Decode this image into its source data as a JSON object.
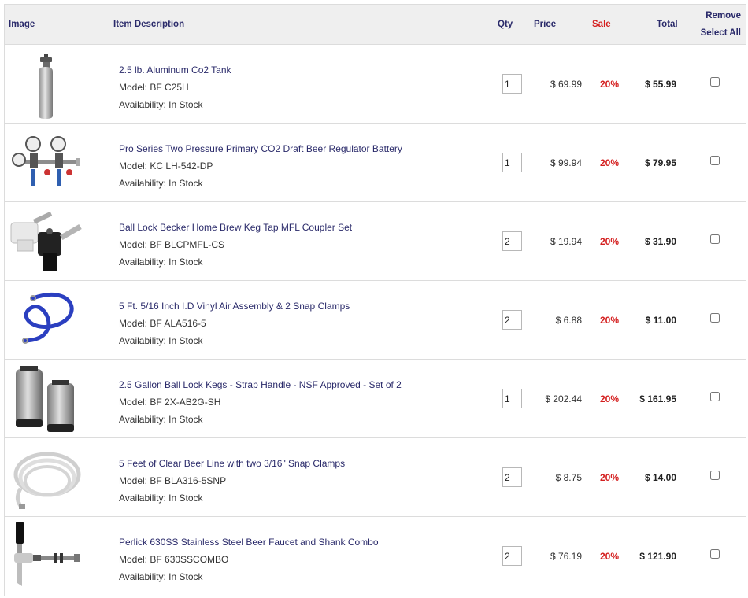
{
  "header": {
    "image": "Image",
    "description": "Item Description",
    "qty": "Qty",
    "price": "Price",
    "sale": "Sale",
    "total": "Total",
    "remove": "Remove",
    "select_all": "Select All"
  },
  "items": [
    {
      "title": "2.5 lb. Aluminum Co2 Tank",
      "model": "Model: BF C25H",
      "availability": "Availability: In Stock",
      "qty": "1",
      "price": "$ 69.99",
      "sale": "20%",
      "total": "$ 55.99"
    },
    {
      "title": "Pro Series Two Pressure Primary CO2 Draft Beer Regulator Battery",
      "model": "Model: KC LH-542-DP",
      "availability": "Availability: In Stock",
      "qty": "1",
      "price": "$ 99.94",
      "sale": "20%",
      "total": "$ 79.95"
    },
    {
      "title": "Ball Lock Becker Home Brew Keg Tap MFL Coupler Set",
      "model": "Model: BF BLCPMFL-CS",
      "availability": "Availability: In Stock",
      "qty": "2",
      "price": "$ 19.94",
      "sale": "20%",
      "total": "$ 31.90"
    },
    {
      "title": "5 Ft. 5/16 Inch I.D Vinyl Air Assembly & 2 Snap Clamps",
      "model": "Model: BF ALA516-5",
      "availability": "Availability: In Stock",
      "qty": "2",
      "price": "$ 6.88",
      "sale": "20%",
      "total": "$ 11.00"
    },
    {
      "title": "2.5 Gallon Ball Lock Kegs - Strap Handle - NSF Approved - Set of 2",
      "model": "Model: BF 2X-AB2G-SH",
      "availability": "Availability: In Stock",
      "qty": "1",
      "price": "$ 202.44",
      "sale": "20%",
      "total": "$ 161.95"
    },
    {
      "title": "5 Feet of Clear Beer Line with two 3/16\" Snap Clamps",
      "model": "Model: BF BLA316-5SNP",
      "availability": "Availability: In Stock",
      "qty": "2",
      "price": "$ 8.75",
      "sale": "20%",
      "total": "$ 14.00"
    },
    {
      "title": "Perlick 630SS Stainless Steel Beer Faucet and Shank Combo",
      "model": "Model: BF 630SSCOMBO",
      "availability": "Availability: In Stock",
      "qty": "2",
      "price": "$ 76.19",
      "sale": "20%",
      "total": "$ 121.90"
    }
  ],
  "colors": {
    "link": "#2a2a6a",
    "sale": "#d41f1f",
    "header_bg": "#efefef",
    "border": "#dcdcdc"
  }
}
